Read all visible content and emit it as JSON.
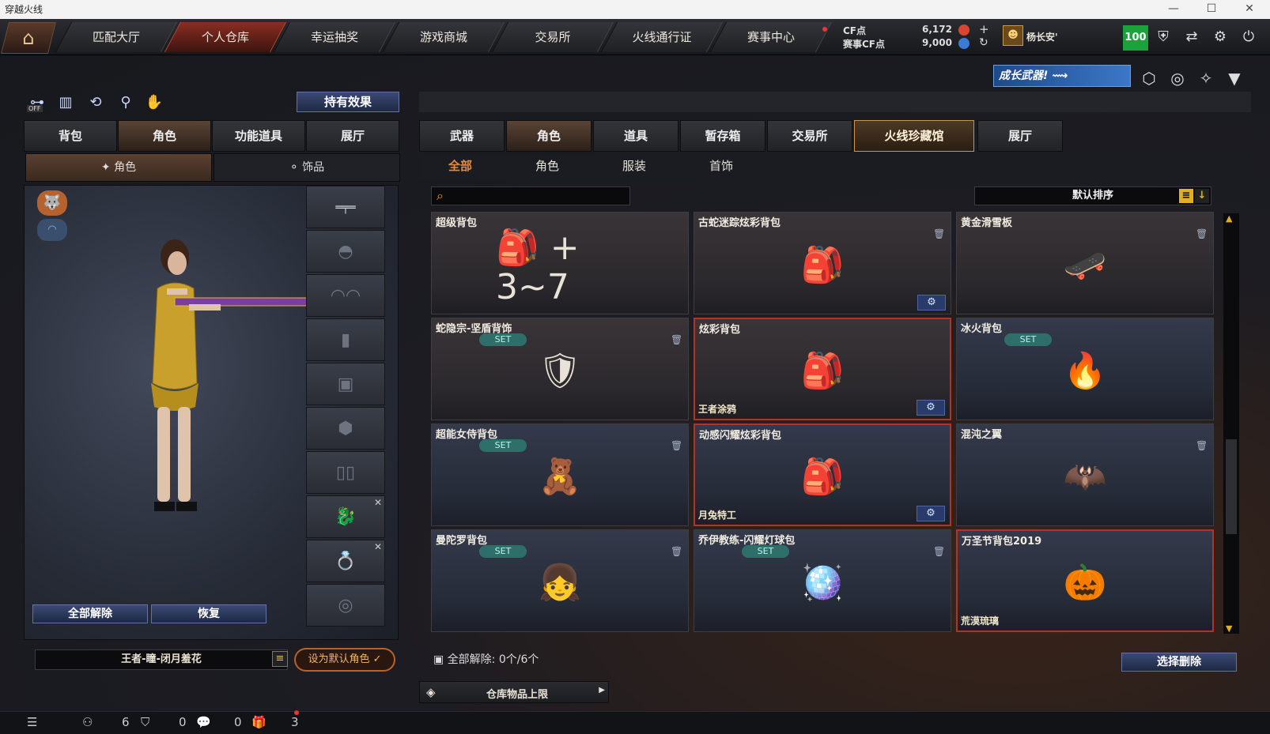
{
  "window": {
    "title": "穿越火线",
    "minimize": "—",
    "maximize": "☐",
    "close": "✕"
  },
  "nav": {
    "home_icon": "home-icon",
    "tabs": [
      "匹配大厅",
      "个人仓库",
      "幸运抽奖",
      "游戏商城",
      "交易所",
      "火线通行证",
      "赛事中心"
    ],
    "active": "个人仓库"
  },
  "currency": {
    "cf_label": "CF点",
    "cf_value": "6,172",
    "match_label": "赛事CF点",
    "match_value": "9,000",
    "add": "+",
    "refresh": "↻"
  },
  "user": {
    "name": "杨长安'",
    "level": "100"
  },
  "banner": {
    "text": "成长武器!"
  },
  "left": {
    "effect_button": "持有效果",
    "off_label": "OFF",
    "tabs": [
      "背包",
      "角色",
      "功能道具",
      "展厅"
    ],
    "subtabs": [
      "角色",
      "饰品"
    ],
    "unequip_all": "全部解除",
    "restore": "恢复",
    "character_name": "王者-瞳-闭月羞花",
    "set_default": "设为默认角色 ✓"
  },
  "right": {
    "tabs": [
      "武器",
      "角色",
      "道具",
      "暂存箱",
      "交易所",
      "火线珍藏馆",
      "展厅"
    ],
    "active_tab": "角色",
    "highlight_tab": "火线珍藏馆",
    "filters": [
      "全部",
      "角色",
      "服装",
      "首饰"
    ],
    "search_placeholder": "",
    "sort_label": "默认排序",
    "items": [
      {
        "name": "超级背包",
        "set": false,
        "trash": false,
        "gear": false,
        "tag": "",
        "style": "brown",
        "art": "🎒 + 3~7"
      },
      {
        "name": "古蛇迷踪炫彩背包",
        "set": false,
        "trash": true,
        "gear": true,
        "tag": "",
        "style": "brown",
        "art": "🎒"
      },
      {
        "name": "黄金滑雪板",
        "set": false,
        "trash": true,
        "gear": false,
        "tag": "",
        "style": "brown",
        "art": "🛹"
      },
      {
        "name": "蛇隐宗-坚盾背饰",
        "set": true,
        "trash": true,
        "gear": false,
        "tag": "",
        "style": "brown",
        "art": "🛡"
      },
      {
        "name": "炫彩背包",
        "set": false,
        "trash": false,
        "gear": true,
        "tag": "王者涂鸦",
        "style": "red",
        "art": "🎒"
      },
      {
        "name": "冰火背包",
        "set": true,
        "trash": false,
        "gear": false,
        "tag": "",
        "style": "blue",
        "art": "🔥"
      },
      {
        "name": "超能女侍背包",
        "set": true,
        "trash": true,
        "gear": false,
        "tag": "",
        "style": "blue",
        "art": "🧸"
      },
      {
        "name": "动感闪耀炫彩背包",
        "set": false,
        "trash": false,
        "gear": true,
        "tag": "月兔特工",
        "style": "bluered",
        "art": "🎒"
      },
      {
        "name": "混沌之翼",
        "set": false,
        "trash": true,
        "gear": false,
        "tag": "",
        "style": "blue",
        "art": "🦇"
      },
      {
        "name": "曼陀罗背包",
        "set": true,
        "trash": true,
        "gear": false,
        "tag": "",
        "style": "blue",
        "art": "👧"
      },
      {
        "name": "乔伊教练-闪耀灯球包",
        "set": true,
        "trash": true,
        "gear": false,
        "tag": "",
        "style": "blue",
        "art": "🪩"
      },
      {
        "name": "万圣节背包2019",
        "set": false,
        "trash": false,
        "gear": false,
        "tag": "荒漠琉璃",
        "style": "bluered",
        "art": "🎃"
      }
    ],
    "set_label": "SET",
    "unequip_summary": "全部解除: 0个/6个",
    "select_delete": "选择删除",
    "warehouse_limit": "仓库物品上限"
  },
  "bottom": {
    "count1": "6",
    "count2": "0",
    "count3": "0",
    "count4": "3"
  }
}
